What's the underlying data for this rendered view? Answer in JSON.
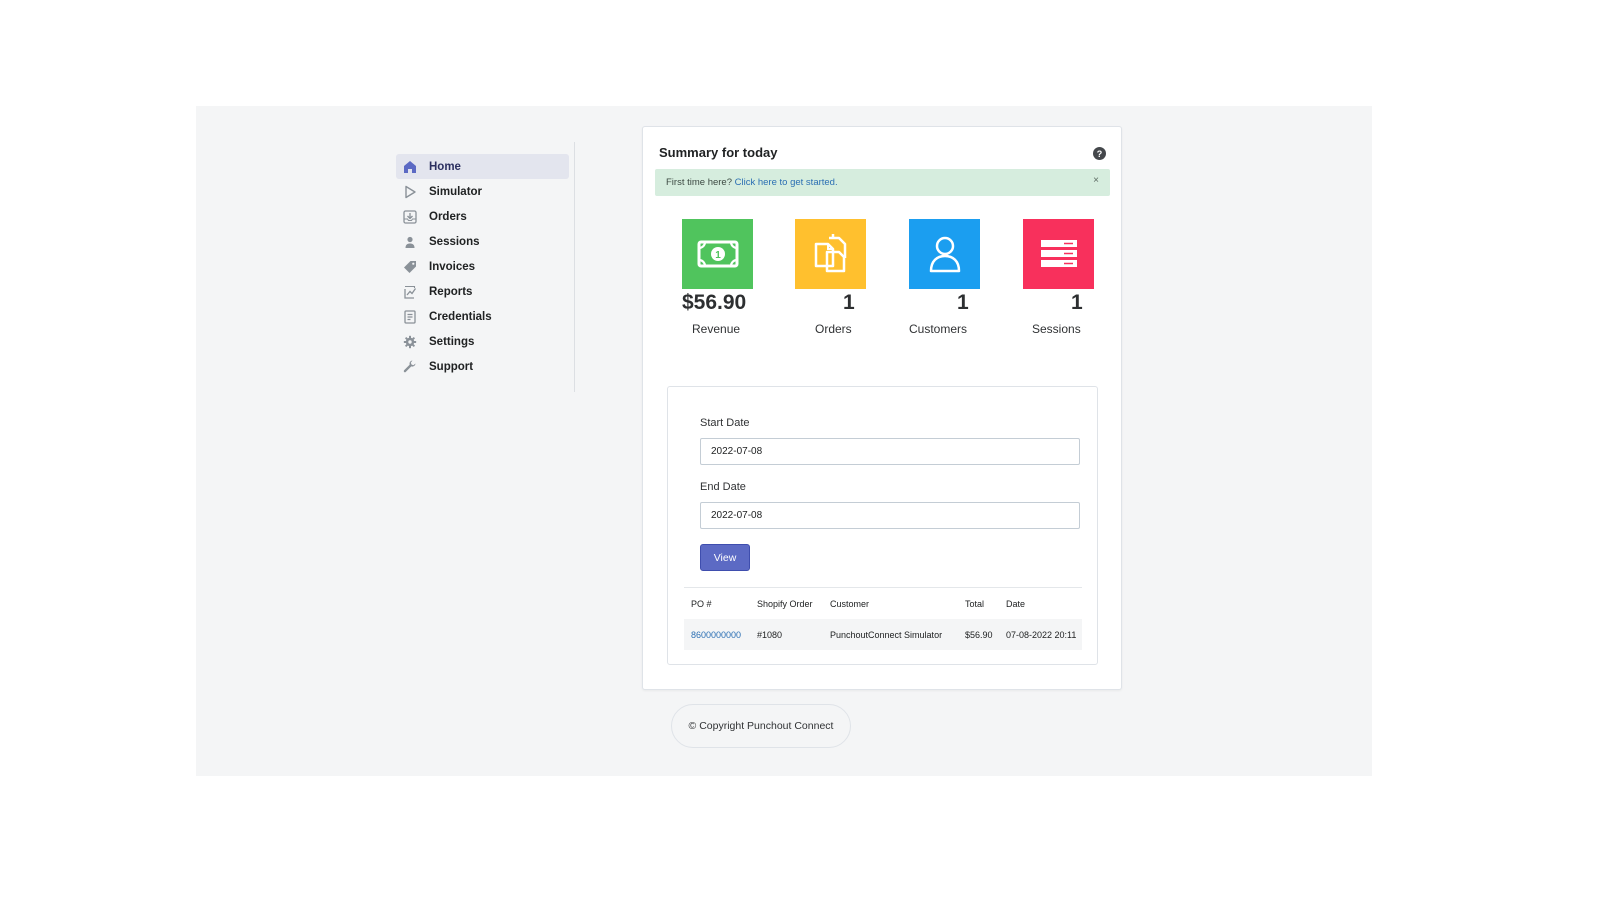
{
  "sidebar": {
    "items": [
      {
        "label": "Home",
        "icon": "home-icon",
        "active": true
      },
      {
        "label": "Simulator",
        "icon": "play-icon"
      },
      {
        "label": "Orders",
        "icon": "inbox-download-icon"
      },
      {
        "label": "Sessions",
        "icon": "person-icon"
      },
      {
        "label": "Invoices",
        "icon": "tag-icon"
      },
      {
        "label": "Reports",
        "icon": "report-chart-icon"
      },
      {
        "label": "Credentials",
        "icon": "document-list-icon"
      },
      {
        "label": "Settings",
        "icon": "gear-icon"
      },
      {
        "label": "Support",
        "icon": "wrench-icon"
      }
    ]
  },
  "summary": {
    "title": "Summary for today",
    "banner_text": "First time here?",
    "banner_link": "Click here to get started.",
    "banner_close": "×",
    "help": "?"
  },
  "stats": [
    {
      "value": "$56.90",
      "caption": "Revenue",
      "color": "#50c45d",
      "icon": "cash-icon"
    },
    {
      "value": "1",
      "caption": "Orders",
      "color": "#ffc02e",
      "icon": "documents-icon"
    },
    {
      "value": "1",
      "caption": "Customers",
      "color": "#1b9ef0",
      "icon": "customer-icon"
    },
    {
      "value": "1",
      "caption": "Sessions",
      "color": "#f8305c",
      "icon": "server-stack-icon"
    }
  ],
  "form": {
    "start_label": "Start Date",
    "start_value": "2022-07-08",
    "end_label": "End Date",
    "end_value": "2022-07-08",
    "view_label": "View"
  },
  "table": {
    "headers": [
      "PO #",
      "Shopify Order",
      "Customer",
      "Total",
      "Date"
    ],
    "rows": [
      [
        "8600000000",
        "#1080",
        "PunchoutConnect Simulator",
        "$56.90",
        "07-08-2022 20:11"
      ]
    ]
  },
  "footer": {
    "copyright": "© Copyright Punchout Connect"
  }
}
